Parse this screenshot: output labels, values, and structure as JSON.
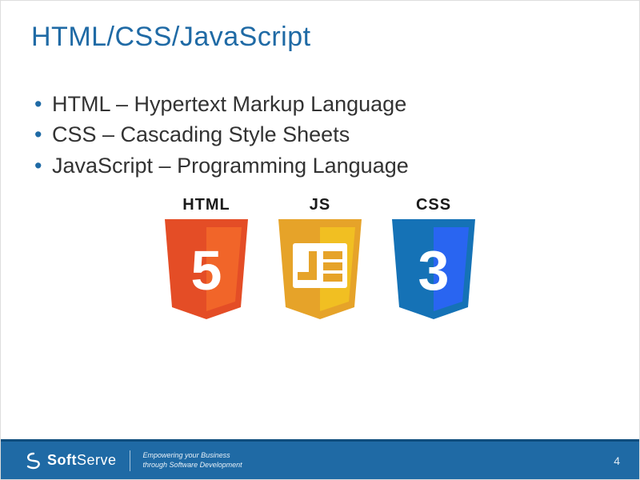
{
  "slide": {
    "title": "HTML/CSS/JavaScript",
    "bullets": [
      "HTML – Hypertext Markup Language",
      "CSS – Cascading Style Sheets",
      "JavaScript – Programming Language"
    ],
    "logos": {
      "html": {
        "label": "HTML",
        "digit": "5"
      },
      "js": {
        "label": "JS"
      },
      "css": {
        "label": "CSS",
        "digit": "3"
      }
    }
  },
  "footer": {
    "brand_prefix": "Soft",
    "brand_suffix": "Serve",
    "tagline_line1": "Empowering your Business",
    "tagline_line2": "through Software Development",
    "page_number": "4"
  }
}
